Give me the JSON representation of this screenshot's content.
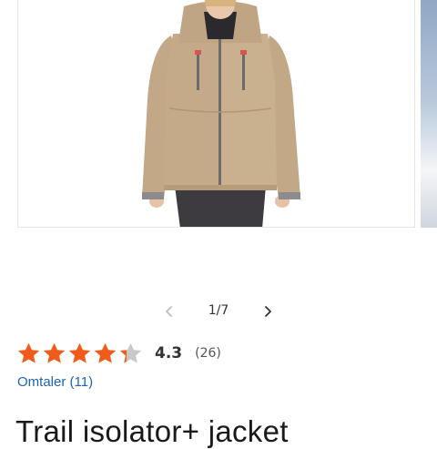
{
  "gallery": {
    "current": "1",
    "total": "7",
    "counter": "1/7"
  },
  "rating": {
    "score": "4.3",
    "value": 4.3,
    "max": 5,
    "count": "(26)",
    "reviews_link": "Omtaler (11)"
  },
  "product": {
    "title": "Trail isolator+ jacket"
  },
  "colors": {
    "star": "#f05a1a",
    "star_empty": "#c8c8c8",
    "link": "#1f63b5"
  }
}
